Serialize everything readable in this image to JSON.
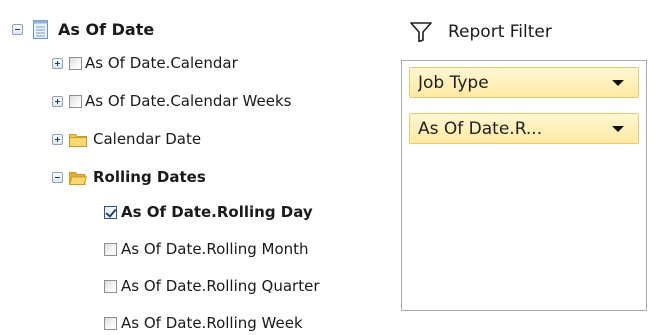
{
  "field_list": {
    "root": {
      "label": "As Of Date"
    },
    "items": [
      {
        "label": "As Of Date.Calendar"
      },
      {
        "label": "As Of Date.Calendar Weeks"
      },
      {
        "label": "Calendar Date"
      },
      {
        "label": "Rolling Dates"
      }
    ],
    "rolling": [
      {
        "label": "As Of Date.Rolling Day",
        "checked": true
      },
      {
        "label": "As Of Date.Rolling Month",
        "checked": false
      },
      {
        "label": "As Of Date.Rolling Quarter",
        "checked": false
      },
      {
        "label": "As Of Date.Rolling Week",
        "checked": false
      }
    ]
  },
  "report_filter": {
    "title": "Report Filter",
    "fields": [
      {
        "label": "Job Type"
      },
      {
        "label": "As Of Date.R..."
      }
    ]
  }
}
